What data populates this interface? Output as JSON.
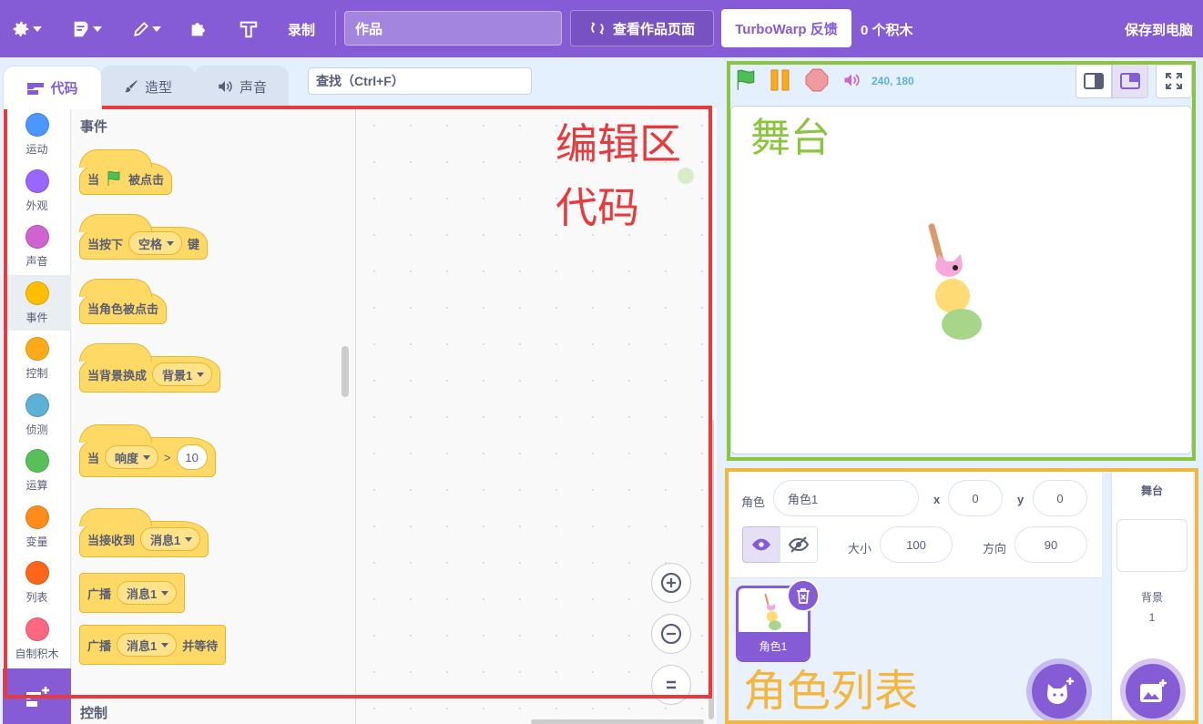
{
  "menubar": {
    "record_label": "录制",
    "project_title_value": "作品",
    "see_project_label": "查看作品页面",
    "feedback_label": "TurboWarp 反馈",
    "block_count_label": "0 个积木",
    "save_label": "保存到电脑"
  },
  "tabs": {
    "code": "代码",
    "costumes": "造型",
    "sounds": "声音"
  },
  "search": {
    "placeholder": "查找（Ctrl+F）"
  },
  "categories": [
    {
      "label": "运动",
      "color": "#4c97ff"
    },
    {
      "label": "外观",
      "color": "#9966ff"
    },
    {
      "label": "声音",
      "color": "#cf63cf"
    },
    {
      "label": "事件",
      "color": "#ffbf00"
    },
    {
      "label": "控制",
      "color": "#ffab19"
    },
    {
      "label": "侦测",
      "color": "#5cb1d6"
    },
    {
      "label": "运算",
      "color": "#59c059"
    },
    {
      "label": "变量",
      "color": "#ff8c1a"
    },
    {
      "label": "列表",
      "color": "#ff661a"
    },
    {
      "label": "自制积木",
      "color": "#ff6680"
    }
  ],
  "flyout": {
    "section_events": "事件",
    "section_control": "控制",
    "blocks": {
      "when_flag_prefix": "当",
      "when_flag_suffix": "被点击",
      "when_key_prefix": "当按下",
      "when_key_value": "空格",
      "when_key_suffix": "键",
      "when_sprite_clicked": "当角色被点击",
      "when_backdrop_prefix": "当背景换成",
      "when_backdrop_value": "背景1",
      "when_greater_prefix": "当",
      "when_greater_value": "响度",
      "when_greater_op": ">",
      "when_greater_num": "10",
      "when_receive_prefix": "当接收到",
      "when_receive_value": "消息1",
      "broadcast_prefix": "广播",
      "broadcast_value": "消息1",
      "broadcast_wait_prefix": "广播",
      "broadcast_wait_value": "消息1",
      "broadcast_wait_suffix": "并等待"
    }
  },
  "zoom": {
    "in": "+",
    "out": "−",
    "reset": "="
  },
  "stage_header": {
    "coords": "240, 180"
  },
  "sprite_info": {
    "sprite_label": "角色",
    "sprite_name": "角色1",
    "x_label": "x",
    "x_value": "0",
    "y_label": "y",
    "y_value": "0",
    "size_label": "大小",
    "size_value": "100",
    "direction_label": "方向",
    "direction_value": "90"
  },
  "sprite_list": [
    {
      "name": "角色1",
      "selected": true
    }
  ],
  "stage_pane": {
    "title": "舞台",
    "backdrop_label": "背景",
    "backdrop_count": "1"
  },
  "annotations": {
    "editor": "编辑区",
    "code": "代码",
    "stage": "舞台",
    "sprites": "角色列表"
  },
  "colors": {
    "menubar": "#855cd6",
    "events_block": "#ffd965",
    "editor_frame": "#e8393c",
    "stage_frame": "#8bc53f",
    "sprite_frame": "#f4b73e"
  }
}
